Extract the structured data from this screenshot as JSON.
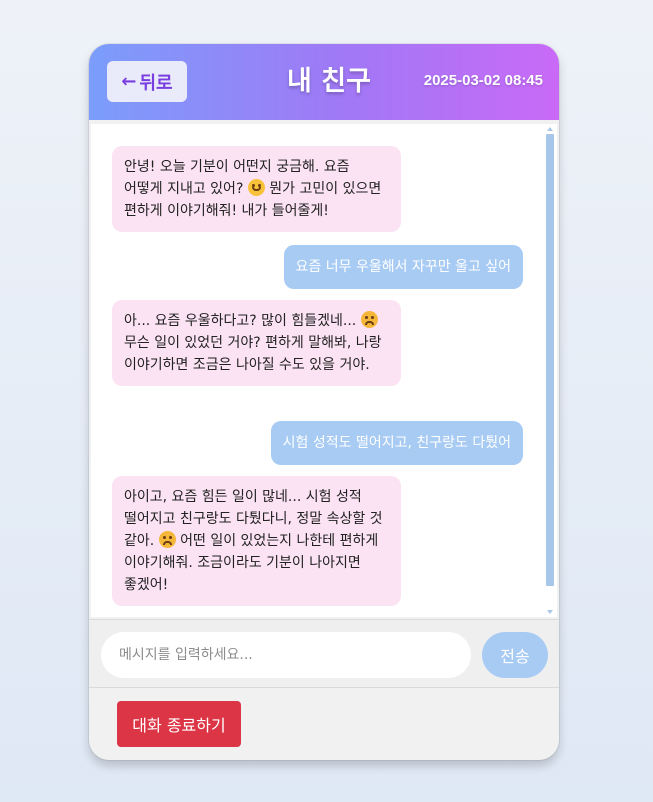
{
  "header": {
    "back_label": "뒤로",
    "back_arrow": "←",
    "title": "내 친구",
    "datetime": "2025-03-02 08:45"
  },
  "messages": [
    {
      "role": "bot",
      "parts": [
        "안녕! 오늘 기분이 어떤지 궁금해. 요즘 어떻게 지내고 있어? ",
        " 뭔가 고민이 있으면 편하게 이야기해줘! 내가 들어줄게!"
      ],
      "emoji": "smile-emoji"
    },
    {
      "role": "user",
      "text": "요즘 너무 우울해서 자꾸만 울고 싶어"
    },
    {
      "role": "bot",
      "parts": [
        "아... 요즘 우울하다고? 많이 힘들겠네... ",
        " 무슨 일이 있었던 거야? 편하게 말해봐, 나랑 이야기하면 조금은 나아질 수도 있을 거야."
      ],
      "emoji": "sad-emoji"
    },
    {
      "role": "user",
      "text": "시험 성적도 떨어지고, 친구랑도 다퉜어"
    },
    {
      "role": "bot",
      "parts": [
        "아이고, 요즘 힘든 일이 많네... 시험 성적 떨어지고 친구랑도 다퉜다니, 정말 속상할 것 같아. ",
        " 어떤 일이 있었는지 나한테 편하게 이야기해줘. 조금이라도 기분이 나아지면 좋겠어!"
      ],
      "emoji": "sad-emoji"
    }
  ],
  "input": {
    "placeholder": "메시지를 입력하세요...",
    "value": "",
    "send_label": "전송"
  },
  "footer": {
    "end_label": "대화 종료하기"
  },
  "colors": {
    "header_gradient_start": "#7b9dfb",
    "header_gradient_end": "#c96af7",
    "bot_bubble": "#fbe3f3",
    "user_bubble": "#a8cbf4",
    "end_button": "#dc3545",
    "back_text": "#7a3ee0"
  }
}
